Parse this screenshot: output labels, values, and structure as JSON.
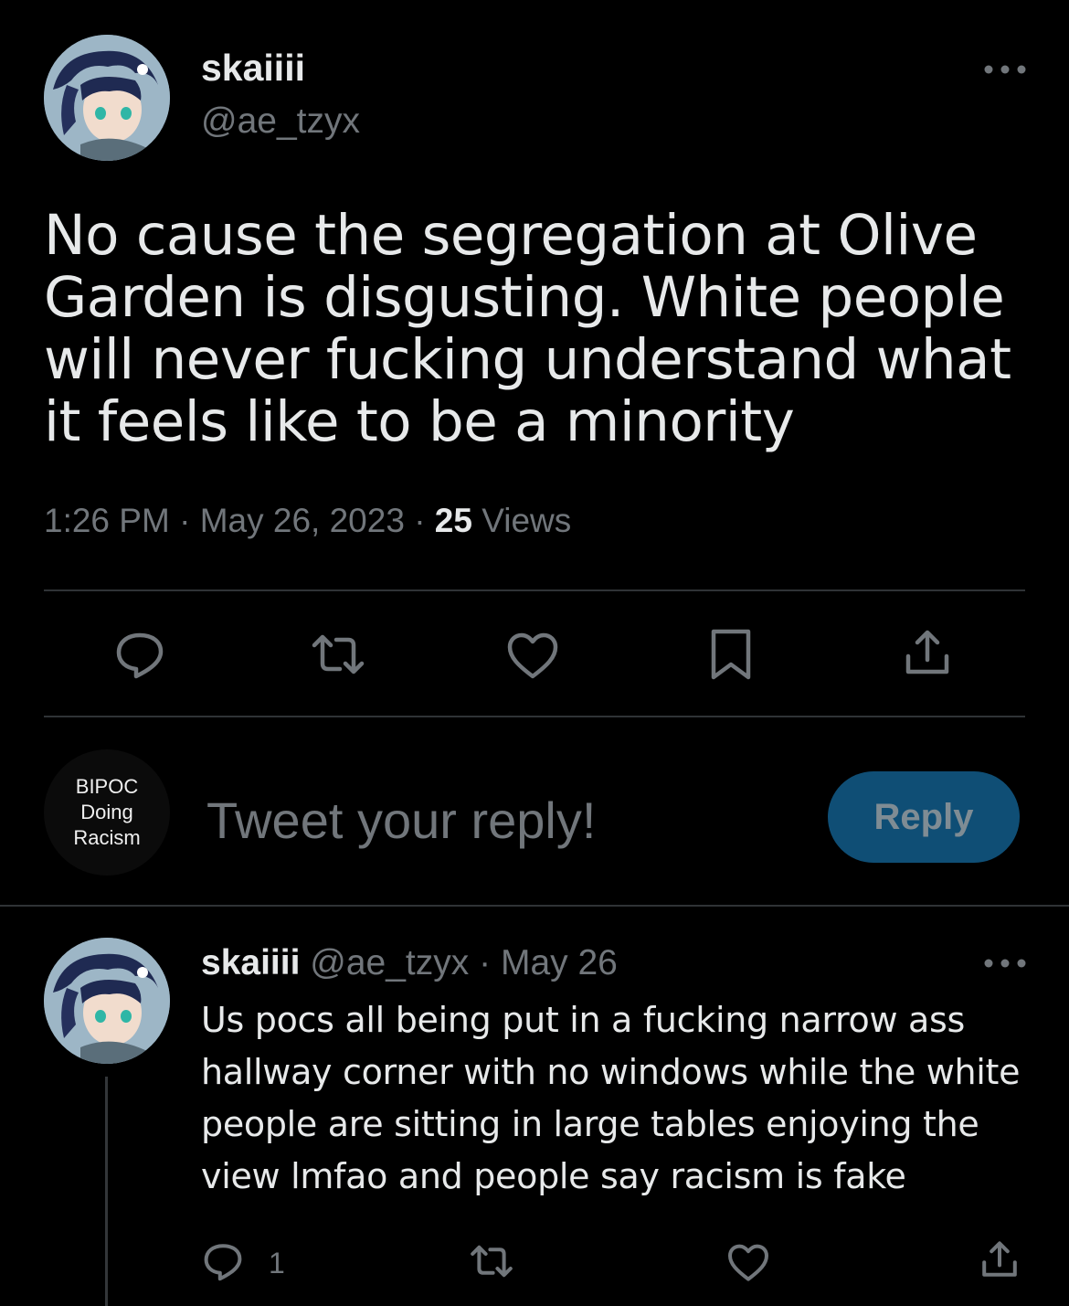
{
  "tweet": {
    "display_name": "skaiiii",
    "handle": "@ae_tzyx",
    "text": "No cause the segregation at Olive Garden is disgusting. White people will never fucking understand what it feels like to be a minority",
    "time": "1:26 PM",
    "separator": "·",
    "date": "May 26, 2023",
    "views_count": "25",
    "views_label": "Views"
  },
  "composer": {
    "avatar_text_line1": "BIPOC",
    "avatar_text_line2": "Doing",
    "avatar_text_line3": "Racism",
    "placeholder": "Tweet your reply!",
    "button_label": "Reply"
  },
  "reply": {
    "display_name": "skaiiii",
    "handle": "@ae_tzyx",
    "separator": "·",
    "date": "May 26",
    "text": "Us pocs all being put in a fucking narrow ass hallway corner with no windows while the white people are sitting in large tables enjoying the view lmfao and people say racism is fake",
    "reply_count": "1"
  },
  "colors": {
    "background": "#000000",
    "text_primary": "#e7e9ea",
    "text_secondary": "#71767b",
    "divider": "#2f3336",
    "reply_button": "#0f4e75"
  },
  "icons": [
    "more-icon",
    "comment-icon",
    "retweet-icon",
    "like-icon",
    "bookmark-icon",
    "share-icon"
  ]
}
